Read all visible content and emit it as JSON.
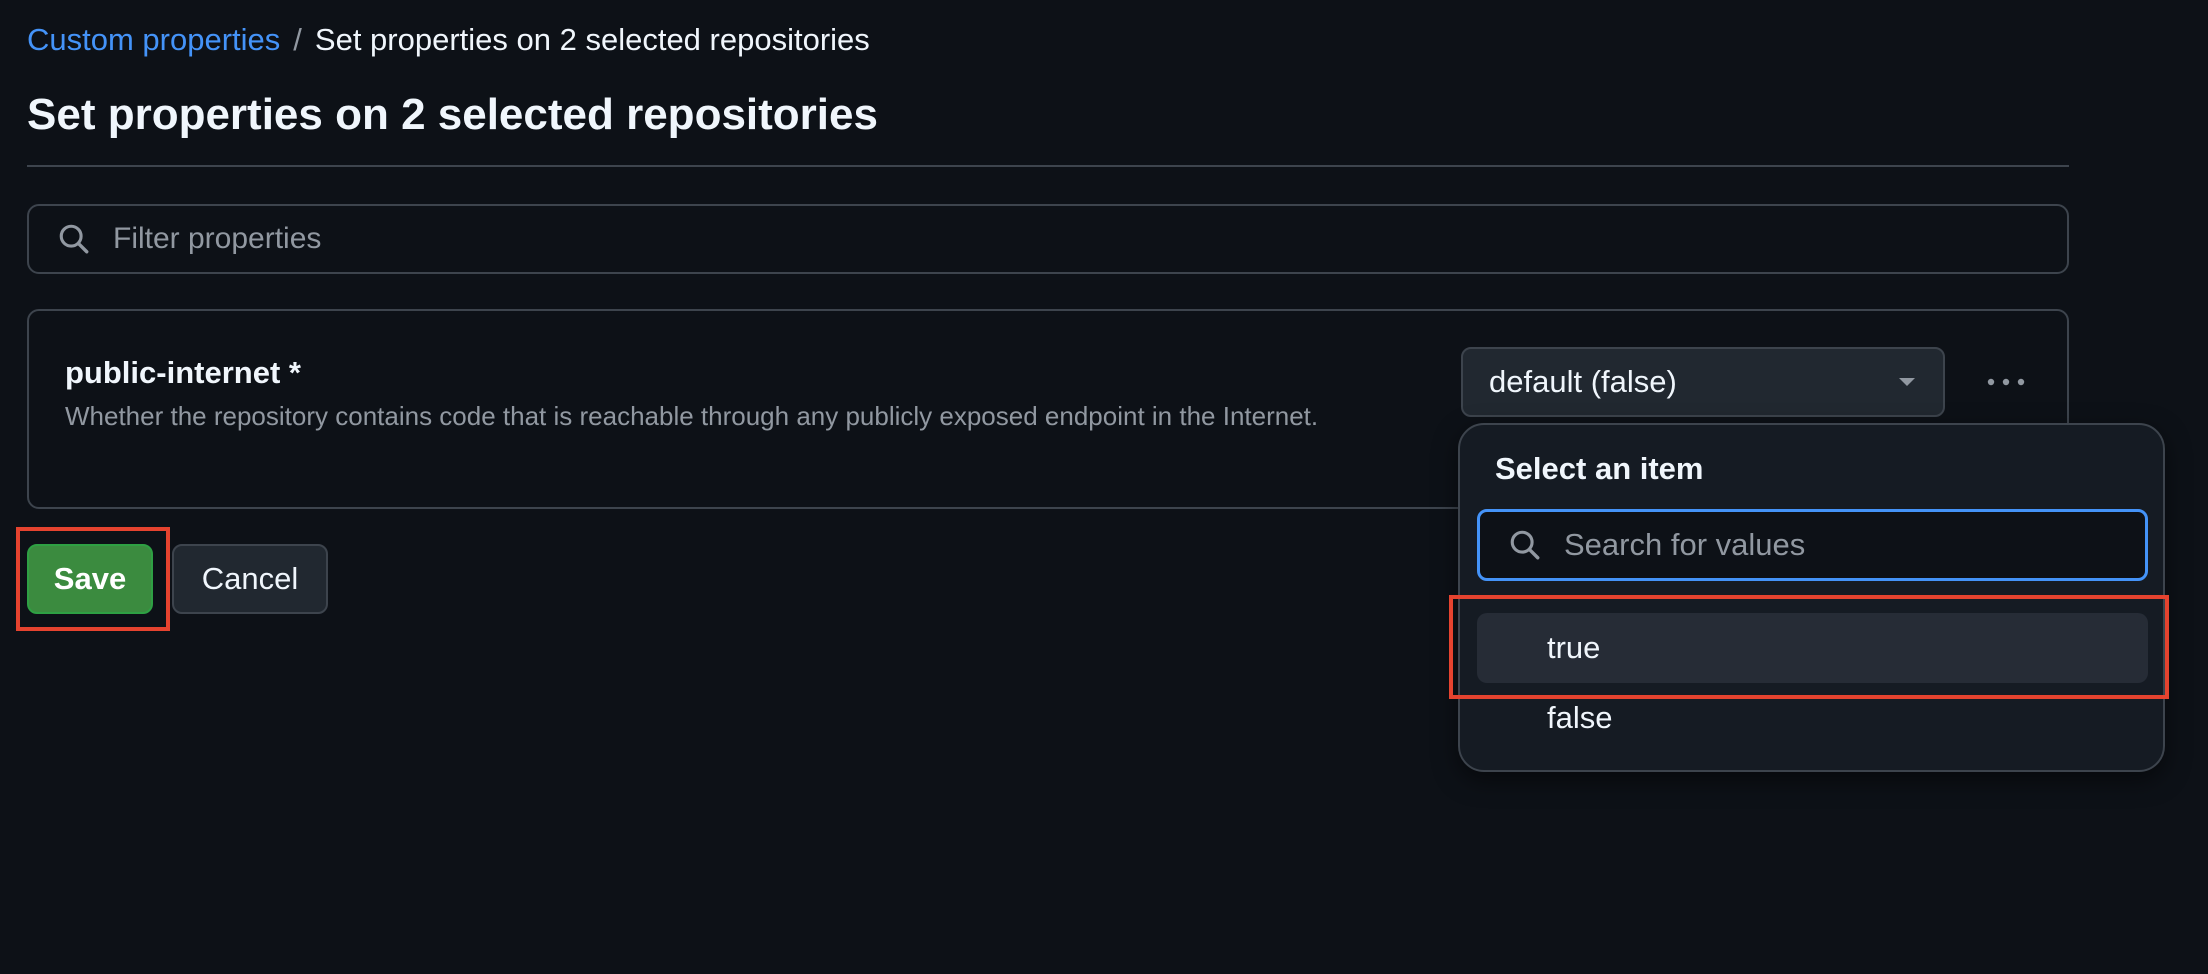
{
  "breadcrumb": {
    "parent": "Custom properties",
    "separator": "/",
    "current": "Set properties on 2 selected repositories"
  },
  "page_title": "Set properties on 2 selected repositories",
  "filter": {
    "placeholder": "Filter properties",
    "value": ""
  },
  "property": {
    "name": "public-internet *",
    "description": "Whether the repository contains code that is reachable through any publicly exposed endpoint in the Internet.",
    "selected_value": "default (false)"
  },
  "actions": {
    "save_label": "Save",
    "cancel_label": "Cancel"
  },
  "dropdown": {
    "title": "Select an item",
    "search_placeholder": "Search for values",
    "options": [
      {
        "label": "true",
        "active": true
      },
      {
        "label": "false",
        "active": false
      }
    ]
  },
  "colors": {
    "background": "#0d1117",
    "link": "#4493f8",
    "save_green": "#3b8b3f",
    "focus_blue": "#4493f8",
    "annotation_red": "#e5432f"
  },
  "icons": {
    "filter": "search-icon",
    "select": "triangle-down-icon",
    "menu": "kebab-horizontal-icon",
    "dropdown_search": "search-icon"
  }
}
